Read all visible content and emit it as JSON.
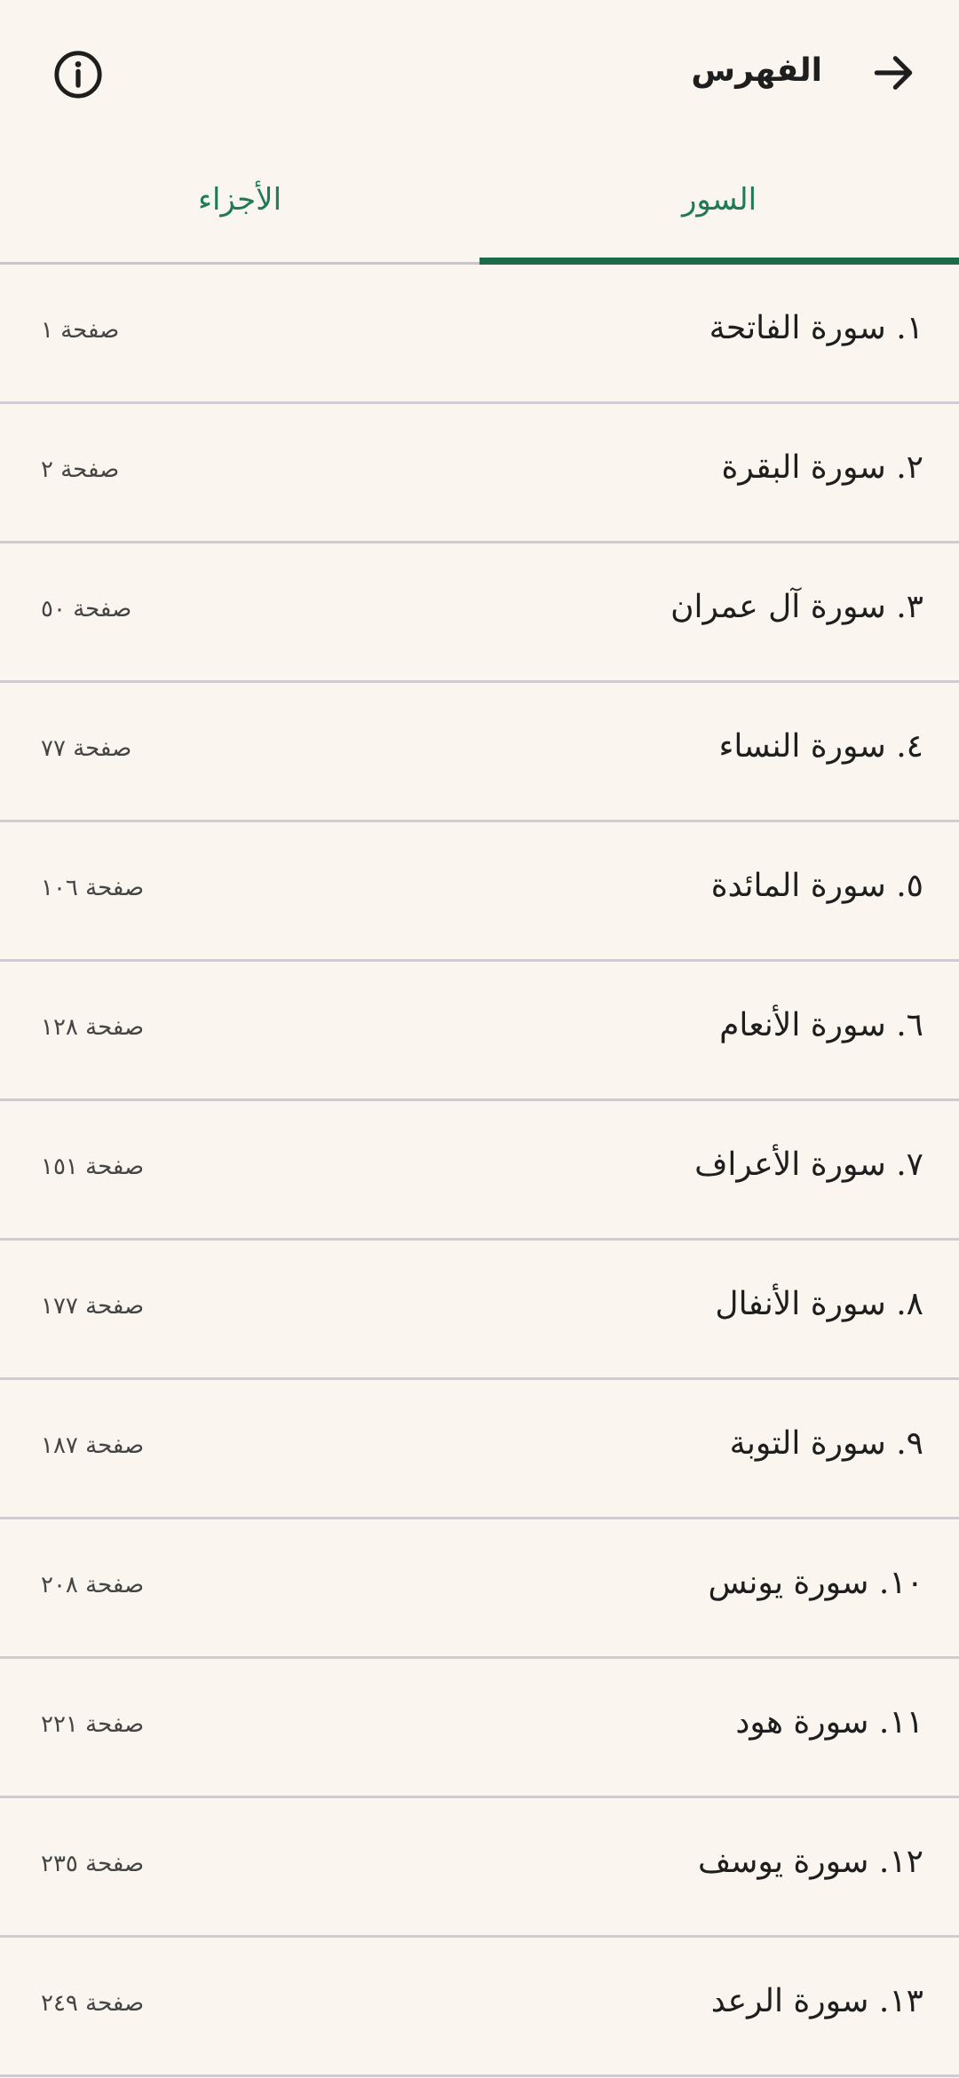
{
  "header": {
    "title": "الفهرس",
    "back_icon": "arrow-forward-icon",
    "info_icon": "info-circle-icon"
  },
  "tabs": [
    {
      "label": "السور",
      "active": true
    },
    {
      "label": "الأجزاء",
      "active": false
    }
  ],
  "colors": {
    "background": "#faf6ef",
    "accent": "#1d6b4a",
    "tab_text": "#1f7a55",
    "divider": "#cfcbd0"
  },
  "suras": [
    {
      "name": "١.  سورة الفاتحة",
      "page": "صفحة ١"
    },
    {
      "name": "٢.  سورة البقرة",
      "page": "صفحة ٢"
    },
    {
      "name": "٣.  سورة آل عمران",
      "page": "صفحة ٥٠"
    },
    {
      "name": "٤.  سورة النساء",
      "page": "صفحة ٧٧"
    },
    {
      "name": "٥.  سورة المائدة",
      "page": "صفحة ١٠٦"
    },
    {
      "name": "٦.  سورة الأنعام",
      "page": "صفحة ١٢٨"
    },
    {
      "name": "٧.  سورة الأعراف",
      "page": "صفحة ١٥١"
    },
    {
      "name": "٨.  سورة الأنفال",
      "page": "صفحة ١٧٧"
    },
    {
      "name": "٩.  سورة التوبة",
      "page": "صفحة ١٨٧"
    },
    {
      "name": "١٠.  سورة يونس",
      "page": "صفحة ٢٠٨"
    },
    {
      "name": "١١.  سورة هود",
      "page": "صفحة ٢٢١"
    },
    {
      "name": "١٢.  سورة يوسف",
      "page": "صفحة ٢٣٥"
    },
    {
      "name": "١٣.  سورة الرعد",
      "page": "صفحة ٢٤٩"
    }
  ]
}
